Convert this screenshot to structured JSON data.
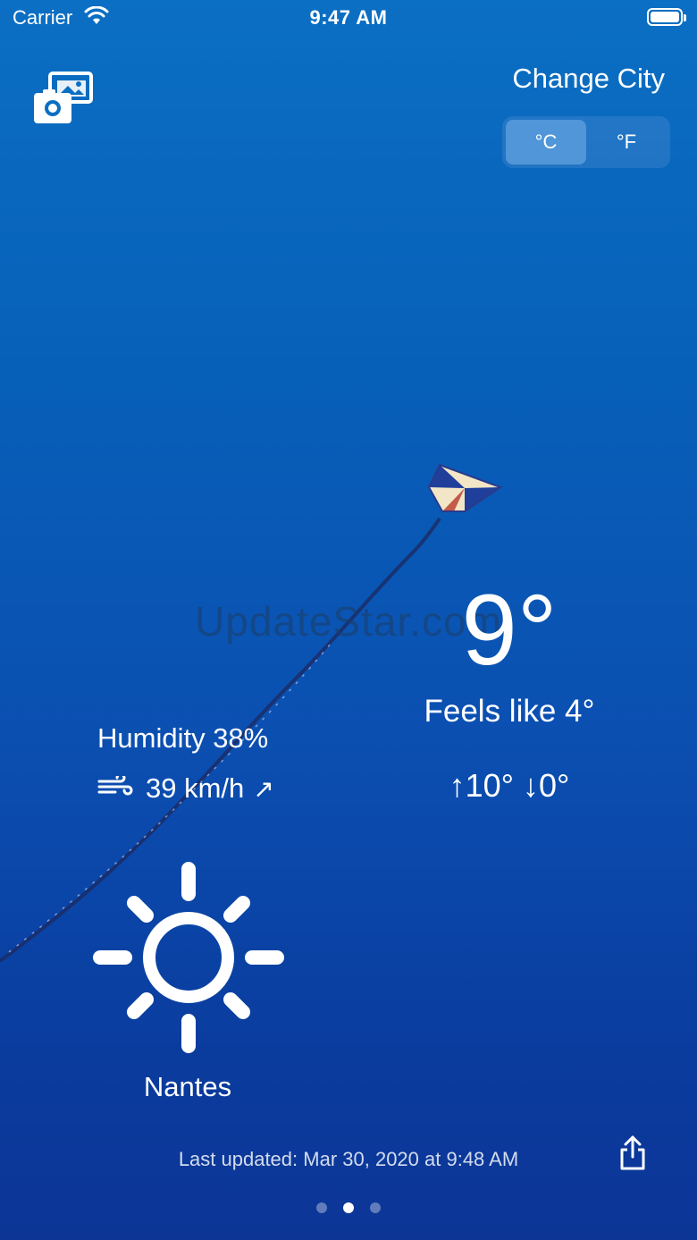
{
  "status_bar": {
    "carrier": "Carrier",
    "time": "9:47 AM",
    "icons": [
      "wifi-icon",
      "battery-icon"
    ]
  },
  "header": {
    "change_city": "Change City",
    "units": [
      {
        "label": "°C",
        "selected": true
      },
      {
        "label": "°F",
        "selected": false
      }
    ],
    "photos_icon": "photo-library-icon"
  },
  "watermark": "UpdateStar.com",
  "weather": {
    "temperature": "9°",
    "feels_like": "Feels like 4°",
    "high_low": "↑10° ↓0°",
    "humidity": "Humidity 38%",
    "wind": "39 km/h",
    "wind_direction": "↗",
    "condition_icon": "sun-icon",
    "city": "Nantes"
  },
  "footer": {
    "last_updated": "Last updated: Mar 30, 2020 at 9:48 AM",
    "share_icon": "share-icon",
    "page_count": 3,
    "current_page": 2
  },
  "colors": {
    "background_top": "#0b6fc3",
    "background_bottom": "#0c3596",
    "text": "#ffffff"
  }
}
